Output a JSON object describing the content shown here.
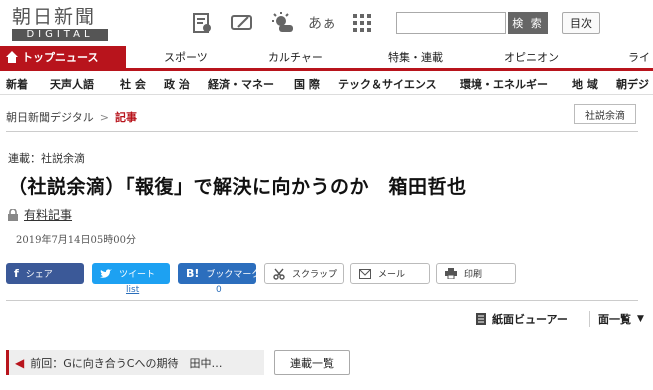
{
  "header": {
    "logo_main": "朝日新聞",
    "logo_sub": "DIGITAL",
    "search_button": "検 索",
    "toc_button": "目次",
    "icon_text": "あぁ"
  },
  "nav_main": {
    "items": [
      "トップニュース",
      "スポーツ",
      "カルチャー",
      "特集・連載",
      "オピニオン",
      "ライ"
    ]
  },
  "nav_sub": {
    "items": [
      "新着",
      "天声人語",
      "社 会",
      "政 治",
      "経済・マネー",
      "国 際",
      "テック＆サイエンス",
      "環境・エネルギー",
      "地 域",
      "朝デジ"
    ]
  },
  "breadcrumb": {
    "home": "朝日新聞デジタル",
    "sep": ">",
    "current": "記事"
  },
  "category_tag": "社説余滴",
  "article": {
    "series": "連載：社説余滴",
    "title": "（社説余滴）「報復」で解決に向かうのか　箱田哲也",
    "paid_label": "有料記事",
    "date": "2019年7月14日05時00分"
  },
  "share": {
    "facebook": "シェア",
    "twitter": "ツイート",
    "hatena": "ブックマーク",
    "clip": "スクラップ",
    "mail": "メール",
    "print": "印刷",
    "twitter_count": "list",
    "hatena_count": "0",
    "fb_glyph": "f",
    "hatena_glyph": "B!"
  },
  "tools": {
    "viewer": "紙面ビューアー",
    "list": "面一覧"
  },
  "footer_nav": {
    "prev": "前回：Gに向き合うCへの期待　田中…",
    "series_list": "連載一覧"
  },
  "colors": {
    "brand_red": "#b8141c",
    "facebook": "#3b5998",
    "twitter": "#1da1f2",
    "hatena": "#2c6ebd"
  }
}
